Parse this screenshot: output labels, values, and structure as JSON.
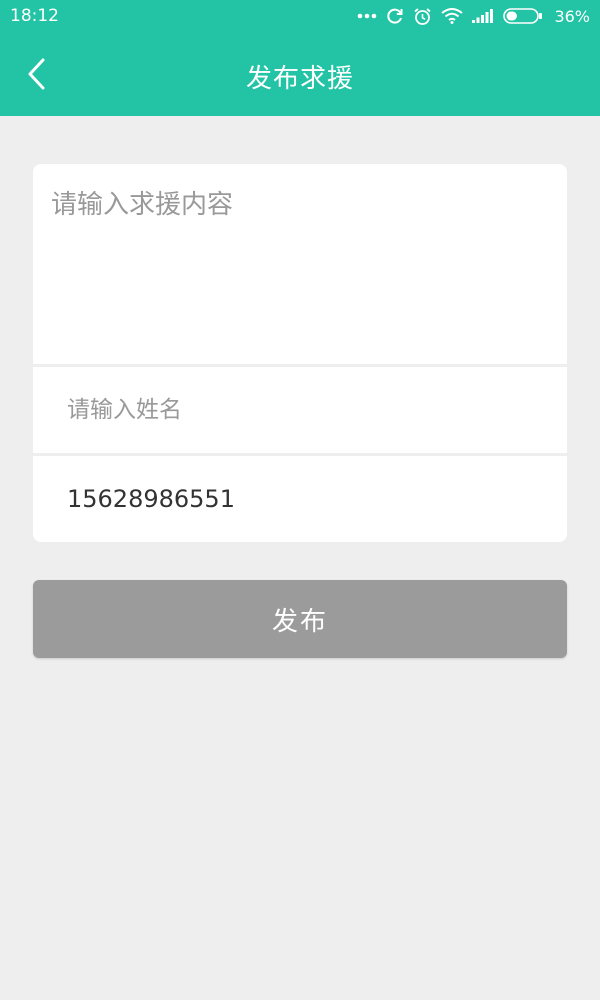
{
  "status_bar": {
    "time": "18:12",
    "battery_percent": "36%",
    "icons": [
      "more-dots-icon",
      "sync-icon",
      "alarm-icon",
      "wifi-icon",
      "signal-icon",
      "battery-icon"
    ],
    "battery_level": 0.36
  },
  "header": {
    "title": "发布求援",
    "back_icon": "chevron-left-icon"
  },
  "form": {
    "content_placeholder": "请输入求援内容",
    "content_value": "",
    "name_placeholder": "请输入姓名",
    "name_value": "",
    "phone_value": "15628986551"
  },
  "actions": {
    "publish_label": "发布"
  },
  "colors": {
    "accent": "#22c4a5",
    "background": "#eeeeee",
    "button_disabled": "#9b9b9b",
    "placeholder": "#999999",
    "text": "#333333"
  }
}
